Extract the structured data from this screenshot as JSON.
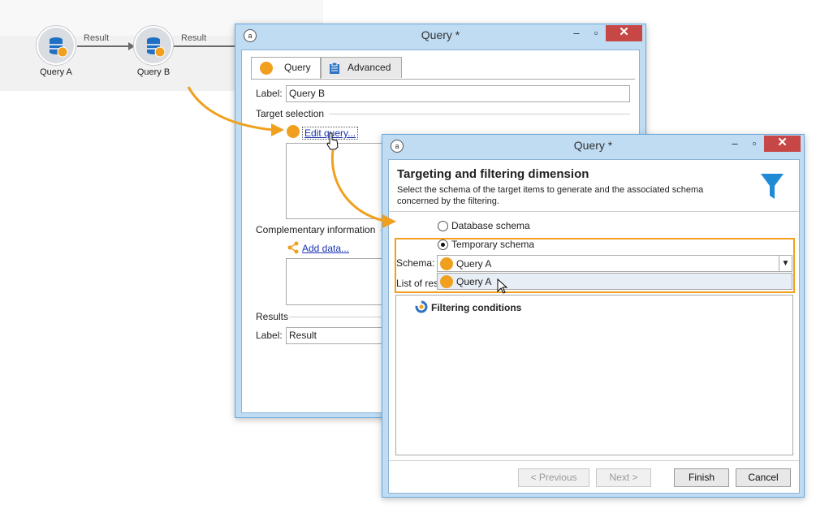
{
  "workflow": {
    "nodes": [
      {
        "label": "Query A"
      },
      {
        "label": "Query B"
      }
    ],
    "transitions": [
      {
        "label": "Result"
      },
      {
        "label": "Result"
      }
    ]
  },
  "query_window": {
    "title": "Query *",
    "tabs": [
      {
        "label": "Query"
      },
      {
        "label": "Advanced"
      }
    ],
    "label_field": {
      "caption": "Label:",
      "value": "Query B"
    },
    "target_selection": {
      "caption": "Target selection",
      "edit_link": "Edit query..."
    },
    "complementary": {
      "caption": "Complementary information",
      "add_link": "Add data..."
    },
    "results": {
      "caption": "Results",
      "label_caption": "Label:",
      "label_value": "Result"
    }
  },
  "targeting_window": {
    "title": "Query *",
    "heading": "Targeting and filtering dimension",
    "description_line1": "Select the schema of the target items to  generate and the associated schema",
    "description_line2": "concerned by the filtering.",
    "radio_database": "Database schema",
    "radio_temporary": "Temporary schema",
    "selected_radio": "Temporary schema",
    "schema_caption": "Schema:",
    "schema_value": "Query A",
    "dropdown_options": [
      "Query A"
    ],
    "list_caption": "List of res",
    "filtering_conditions": "Filtering conditions",
    "buttons": {
      "previous": "< Previous",
      "next": "Next >",
      "finish": "Finish",
      "cancel": "Cancel"
    }
  },
  "colors": {
    "accent_orange": "#f0a01e",
    "window_frame": "#bfdcf3",
    "close_button": "#c74646",
    "link": "#1a34b0",
    "funnel": "#1f8ad6"
  }
}
